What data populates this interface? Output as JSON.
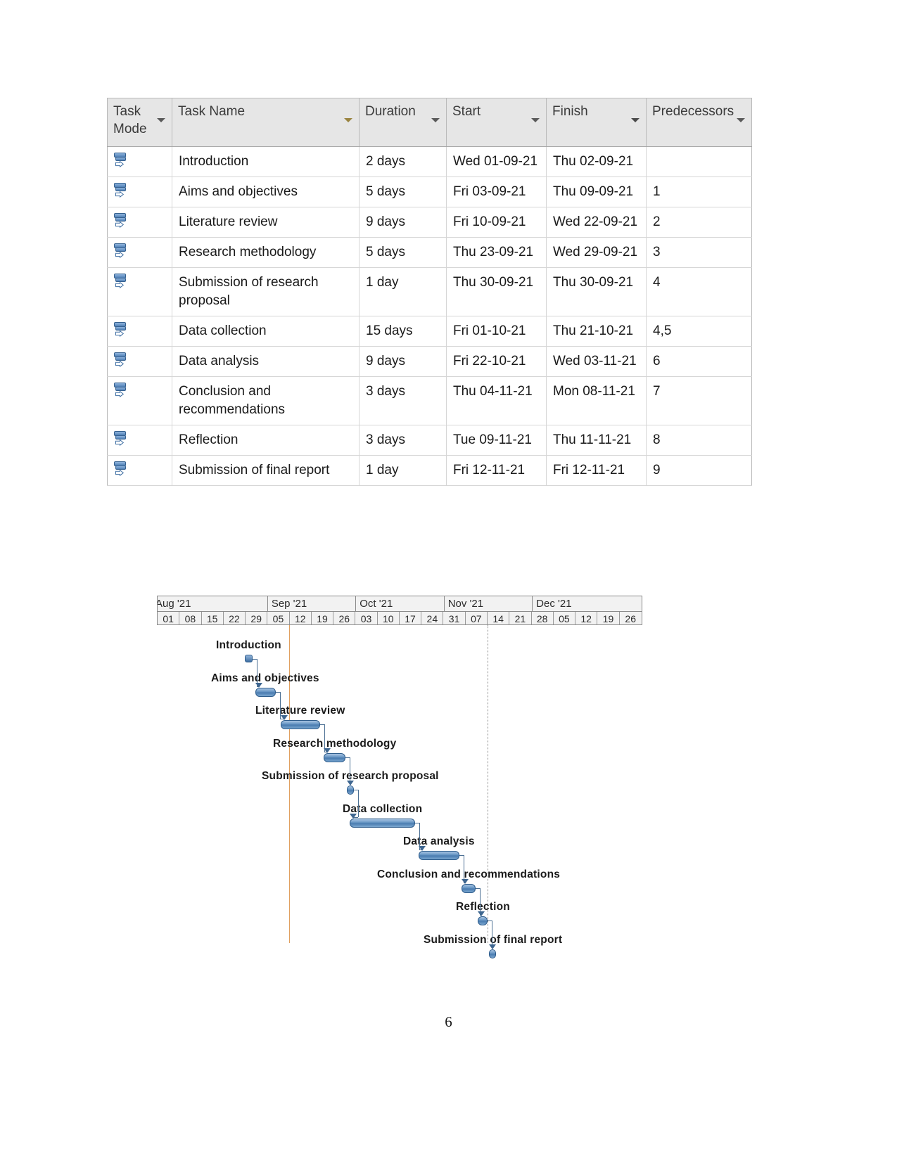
{
  "table": {
    "columns": [
      {
        "key": "task_mode",
        "label": "Task\nMode",
        "label_line1": "Task",
        "label_line2": "Mode",
        "highlight": "none"
      },
      {
        "key": "task_name",
        "label": "Task Name",
        "highlight": "gradient-yellow"
      },
      {
        "key": "duration",
        "label": "Duration",
        "highlight": "none"
      },
      {
        "key": "start",
        "label": "Start",
        "highlight": "none"
      },
      {
        "key": "finish",
        "label": "Finish",
        "highlight": "solid-yellow"
      },
      {
        "key": "predecessors",
        "label": "Predecessors",
        "highlight": "none"
      }
    ],
    "header_labels": {
      "task_mode_line1": "Task",
      "task_mode_line2": "Mode",
      "task_name": "Task Name",
      "duration": "Duration",
      "start": "Start",
      "finish": "Finish",
      "predecessors": "Predecessors"
    },
    "rows": [
      {
        "mode_icon": "auto-schedule-icon",
        "name": "Introduction",
        "duration": "2 days",
        "start": "Wed 01-09-21",
        "finish": "Thu 02-09-21",
        "predecessors": ""
      },
      {
        "mode_icon": "auto-schedule-icon",
        "name": "Aims and objectives",
        "duration": "5 days",
        "start": "Fri 03-09-21",
        "finish": "Thu 09-09-21",
        "predecessors": "1"
      },
      {
        "mode_icon": "auto-schedule-icon",
        "name": "Literature review",
        "duration": "9 days",
        "start": "Fri 10-09-21",
        "finish": "Wed 22-09-21",
        "predecessors": "2"
      },
      {
        "mode_icon": "auto-schedule-icon",
        "name": "Research methodology",
        "duration": "5 days",
        "start": "Thu 23-09-21",
        "finish": "Wed 29-09-21",
        "predecessors": "3"
      },
      {
        "mode_icon": "auto-schedule-icon",
        "name": "Submission of research proposal",
        "duration": "1 day",
        "start": "Thu 30-09-21",
        "finish": "Thu 30-09-21",
        "predecessors": "4"
      },
      {
        "mode_icon": "auto-schedule-icon",
        "name": "Data collection",
        "duration": "15 days",
        "start": "Fri 01-10-21",
        "finish": "Thu 21-10-21",
        "predecessors": "4,5"
      },
      {
        "mode_icon": "auto-schedule-icon",
        "name": "Data analysis",
        "duration": "9 days",
        "start": "Fri 22-10-21",
        "finish": "Wed 03-11-21",
        "predecessors": "6"
      },
      {
        "mode_icon": "auto-schedule-icon",
        "name": "Conclusion and recommendations",
        "duration": "3 days",
        "start": "Thu 04-11-21",
        "finish": "Mon 08-11-21",
        "predecessors": "7"
      },
      {
        "mode_icon": "auto-schedule-icon",
        "name": "Reflection",
        "duration": "3 days",
        "start": "Tue 09-11-21",
        "finish": "Thu 11-11-21",
        "predecessors": "8"
      },
      {
        "mode_icon": "auto-schedule-icon",
        "name": "Submission of final report",
        "duration": "1 day",
        "start": "Fri 12-11-21",
        "finish": "Fri 12-11-21",
        "predecessors": "9"
      }
    ]
  },
  "chart_data": {
    "type": "bar",
    "title": "",
    "xlabel": "",
    "ylabel": "",
    "orientation": "horizontal-gantt",
    "timeline": {
      "months": [
        {
          "label": "Aug '21",
          "weeks": 5,
          "clipped_left": true
        },
        {
          "label": "Sep '21",
          "weeks": 4
        },
        {
          "label": "Oct '21",
          "weeks": 4
        },
        {
          "label": "Nov '21",
          "weeks": 4
        },
        {
          "label": "Dec '21",
          "weeks": 4
        }
      ],
      "weeks": [
        "01",
        "08",
        "15",
        "22",
        "29",
        "05",
        "12",
        "19",
        "26",
        "03",
        "10",
        "17",
        "24",
        "31",
        "07",
        "14",
        "21",
        "28",
        "05",
        "12",
        "19",
        "26"
      ],
      "first_week_clipped": true
    },
    "today_line_week_index": 6,
    "status_line_week_index": 15,
    "tasks": [
      {
        "name": "Introduction",
        "start": "Wed 01-09-21",
        "finish": "Thu 02-09-21",
        "duration_days": 2,
        "start_week_index": 4,
        "length_weeks": 0.3,
        "milestone": true
      },
      {
        "name": "Aims and objectives",
        "start": "Fri 03-09-21",
        "finish": "Thu 09-09-21",
        "duration_days": 5,
        "start_week_index": 4.45,
        "length_weeks": 0.95,
        "milestone": false
      },
      {
        "name": "Literature review",
        "start": "Fri 10-09-21",
        "finish": "Wed 22-09-21",
        "duration_days": 9,
        "start_week_index": 5.6,
        "length_weeks": 1.8,
        "milestone": false
      },
      {
        "name": "Research methodology",
        "start": "Thu 23-09-21",
        "finish": "Wed 29-09-21",
        "duration_days": 5,
        "start_week_index": 7.55,
        "length_weeks": 1.0,
        "milestone": false
      },
      {
        "name": "Submission of research proposal",
        "start": "Thu 30-09-21",
        "finish": "Thu 30-09-21",
        "duration_days": 1,
        "start_week_index": 8.6,
        "length_weeks": 0.18,
        "milestone": false
      },
      {
        "name": "Data collection",
        "start": "Fri 01-10-21",
        "finish": "Thu 21-10-21",
        "duration_days": 15,
        "start_week_index": 8.75,
        "length_weeks": 2.95,
        "milestone": false
      },
      {
        "name": "Data analysis",
        "start": "Fri 22-10-21",
        "finish": "Wed 03-11-21",
        "duration_days": 9,
        "start_week_index": 11.85,
        "length_weeks": 1.85,
        "milestone": false
      },
      {
        "name": "Conclusion and recommendations",
        "start": "Thu 04-11-21",
        "finish": "Mon 08-11-21",
        "duration_days": 3,
        "start_week_index": 13.8,
        "length_weeks": 0.65,
        "milestone": false
      },
      {
        "name": "Reflection",
        "start": "Tue 09-11-21",
        "finish": "Thu 11-11-21",
        "duration_days": 3,
        "start_week_index": 14.55,
        "length_weeks": 0.45,
        "milestone": false
      },
      {
        "name": "Submission of final report",
        "start": "Fri 12-11-21",
        "finish": "Fri 12-11-21",
        "duration_days": 1,
        "start_week_index": 15.05,
        "length_weeks": 0.2,
        "milestone": false
      }
    ],
    "colors": {
      "bar_fill": "#4a7cb0",
      "bar_border": "#2f5d8c",
      "today_line": "#e0a060",
      "status_line": "#8c8c8c",
      "link": "#4b6f93"
    }
  },
  "footer": {
    "page_number": "6"
  }
}
